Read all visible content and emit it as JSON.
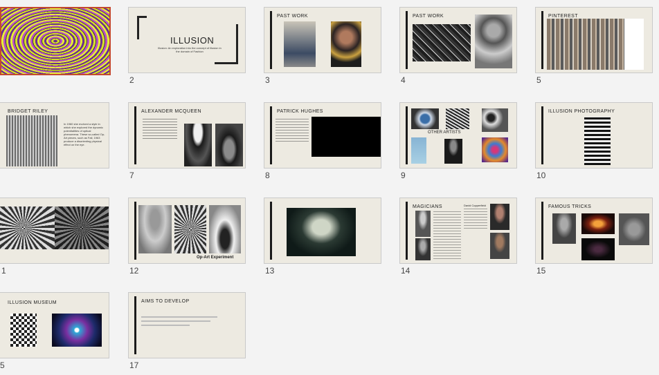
{
  "slides": [
    {
      "number": "",
      "title": ""
    },
    {
      "number": "2",
      "title": "ILLUSION",
      "subtitle": "Illusion: An exploration into the concept of illusion in the domain of Fashion"
    },
    {
      "number": "3",
      "title": "PAST WORK"
    },
    {
      "number": "4",
      "title": "PAST WORK"
    },
    {
      "number": "5",
      "title": "PINTEREST"
    },
    {
      "number": "",
      "title": "BRIDGET RILEY",
      "body": "In 1960 she evolved a style in which she explored the dynamic potentialities of optical phenomena. These so-called Op-Art pieces, such as Fall, 1963 produce a disorienting physical effect on the eye."
    },
    {
      "number": "7",
      "title": "ALEXANDER MCQUEEN"
    },
    {
      "number": "8",
      "title": "PATRICK HUGHES"
    },
    {
      "number": "9",
      "title": "OTHER ARTISTS"
    },
    {
      "number": "10",
      "title": "ILLUSION PHOTOGRAPHY"
    },
    {
      "number": "1",
      "title": ""
    },
    {
      "number": "12",
      "title": "",
      "caption": "Op-Art Experiment"
    },
    {
      "number": "13",
      "title": ""
    },
    {
      "number": "14",
      "title": "MAGICIANS",
      "subtitle": "David Copperfield"
    },
    {
      "number": "15",
      "title": "FAMOUS TRICKS"
    },
    {
      "number": "5",
      "title": "ILLUSION MUSEUM"
    },
    {
      "number": "17",
      "title": "AIMS TO DEVELOP"
    }
  ]
}
